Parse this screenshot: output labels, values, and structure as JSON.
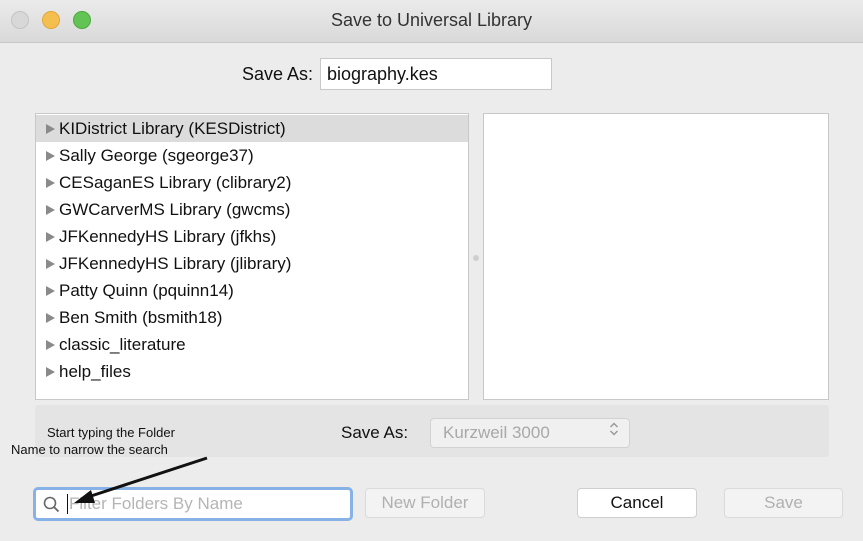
{
  "window": {
    "title": "Save to Universal Library"
  },
  "save_as": {
    "label": "Save As:",
    "filename": "biography.kes"
  },
  "folders": [
    {
      "label": "KIDistrict Library (KESDistrict)",
      "selected": true
    },
    {
      "label": "Sally George (sgeorge37)",
      "selected": false
    },
    {
      "label": "CESaganES Library (clibrary2)",
      "selected": false
    },
    {
      "label": "GWCarverMS Library (gwcms)",
      "selected": false
    },
    {
      "label": "JFKennedyHS Library (jfkhs)",
      "selected": false
    },
    {
      "label": "JFKennedyHS Library (jlibrary)",
      "selected": false
    },
    {
      "label": "Patty Quinn (pquinn14)",
      "selected": false
    },
    {
      "label": "Ben Smith (bsmith18)",
      "selected": false
    },
    {
      "label": "classic_literature",
      "selected": false
    },
    {
      "label": "help_files",
      "selected": false
    }
  ],
  "annotation": {
    "line1": "Start typing the Folder",
    "line2": "Name to narrow the search"
  },
  "format": {
    "label": "Save As:",
    "selected": "Kurzweil 3000",
    "arrows": "⌃⌄"
  },
  "filter": {
    "placeholder": "Filter Folders By Name"
  },
  "buttons": {
    "new_folder": "New Folder",
    "cancel": "Cancel",
    "save": "Save"
  },
  "colors": {
    "focus_ring": "#87b2e8",
    "close_button": "#d8d8d8",
    "minimize_button": "#f5bf4f",
    "zoom_button": "#61c454",
    "selected_row": "#dcdcdc"
  },
  "icons": {
    "filter": "search-icon",
    "folder_row": "disclosure-triangle-icon",
    "format_select": "up-down-chevron-icon"
  }
}
